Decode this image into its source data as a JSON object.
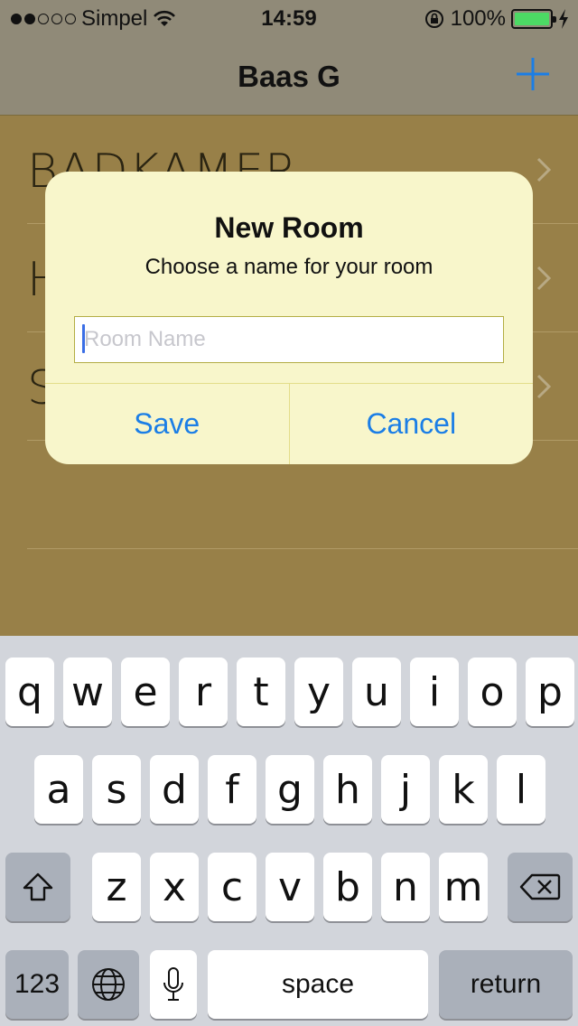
{
  "status_bar": {
    "carrier": "Simpel",
    "time": "14:59",
    "battery_percent": "100%",
    "signal_filled": 2,
    "signal_total": 5,
    "battery_level": 1.0,
    "battery_color": "#4cd964",
    "icons": [
      "wifi-icon",
      "rotation-lock-icon",
      "battery-icon",
      "charging-bolt-icon"
    ]
  },
  "nav": {
    "title": "Baas G",
    "add_icon": "plus-icon",
    "tint": "#1b7ee6"
  },
  "rooms": [
    {
      "label": "BADKAMER"
    },
    {
      "label": "H"
    },
    {
      "label": "S"
    }
  ],
  "alert": {
    "title": "New Room",
    "message": "Choose a name for your room",
    "input_placeholder": "Room Name",
    "input_value": "",
    "save_label": "Save",
    "cancel_label": "Cancel",
    "background": "#f8f6cb",
    "button_color": "#1b7ee6"
  },
  "keyboard": {
    "row1": [
      "q",
      "w",
      "e",
      "r",
      "t",
      "y",
      "u",
      "i",
      "o",
      "p"
    ],
    "row2": [
      "a",
      "s",
      "d",
      "f",
      "g",
      "h",
      "j",
      "k",
      "l"
    ],
    "row3": [
      "z",
      "x",
      "c",
      "v",
      "b",
      "n",
      "m"
    ],
    "numbers_label": "123",
    "space_label": "space",
    "return_label": "return",
    "icons": [
      "shift-icon",
      "backspace-icon",
      "globe-icon",
      "microphone-icon"
    ]
  }
}
